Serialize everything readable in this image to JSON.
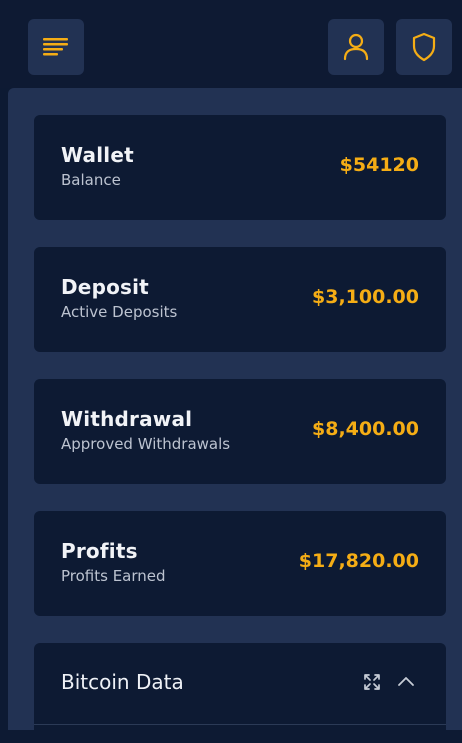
{
  "topbar": {
    "menu_icon": "menu-lines-icon",
    "user_icon": "user-icon",
    "shield_icon": "shield-icon",
    "accent": "#f5ad15"
  },
  "cards": [
    {
      "title": "Wallet",
      "subtitle": "Balance",
      "value": "$54120"
    },
    {
      "title": "Deposit",
      "subtitle": "Active Deposits",
      "value": "$3,100.00"
    },
    {
      "title": "Withdrawal",
      "subtitle": "Approved Withdrawals",
      "value": "$8,400.00"
    },
    {
      "title": "Profits",
      "subtitle": "Profits Earned",
      "value": "$17,820.00"
    }
  ],
  "bitcoin_panel": {
    "title": "Bitcoin Data",
    "expand_icon": "expand-icon",
    "collapse_icon": "chevron-up-icon"
  },
  "colors": {
    "background": "#0d1a33",
    "panel": "#223253",
    "value": "#f5ad15",
    "title": "#f1f3f7",
    "subtitle": "#bcc3d0"
  }
}
